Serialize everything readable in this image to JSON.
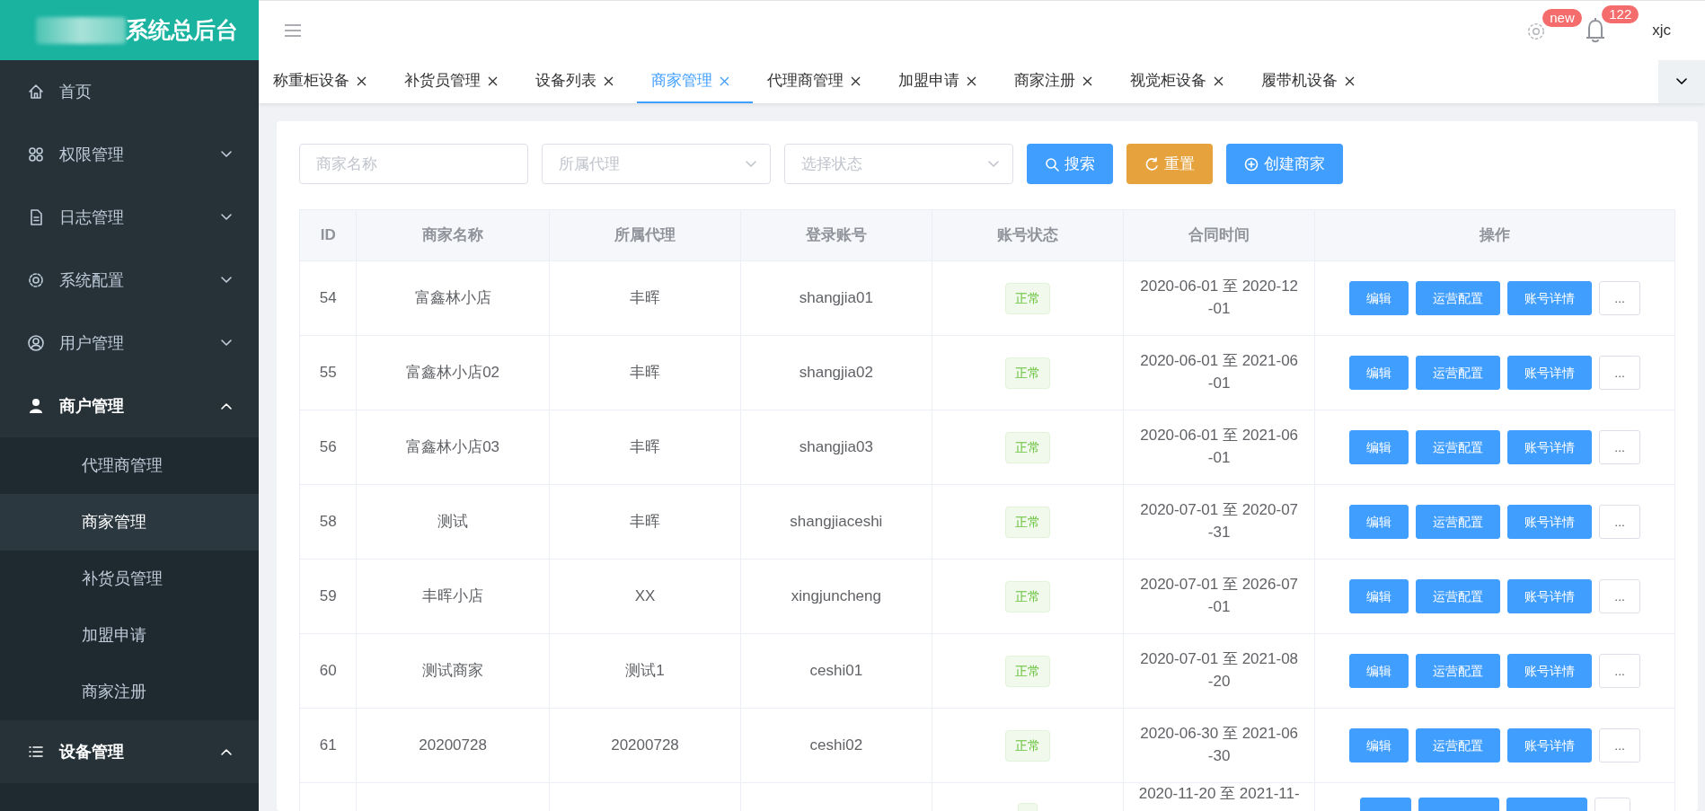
{
  "brand": {
    "title": "系统总后台"
  },
  "sidebar": {
    "items": [
      {
        "label": "首页",
        "kind": "link"
      },
      {
        "label": "权限管理",
        "kind": "menu",
        "expanded": false
      },
      {
        "label": "日志管理",
        "kind": "menu",
        "expanded": false
      },
      {
        "label": "系统配置",
        "kind": "menu",
        "expanded": false
      },
      {
        "label": "用户管理",
        "kind": "menu",
        "expanded": false
      },
      {
        "label": "商户管理",
        "kind": "menu",
        "expanded": true,
        "children": [
          {
            "label": "代理商管理",
            "selected": false
          },
          {
            "label": "商家管理",
            "selected": true
          },
          {
            "label": "补货员管理",
            "selected": false
          },
          {
            "label": "加盟申请",
            "selected": false
          },
          {
            "label": "商家注册",
            "selected": false
          }
        ]
      },
      {
        "label": "设备管理",
        "kind": "menu",
        "expanded": true
      }
    ]
  },
  "header": {
    "settings_badge": "new",
    "notification_badge": "122",
    "user": "xjc"
  },
  "tabs": [
    {
      "label": "称重柜设备",
      "selected": false
    },
    {
      "label": "补货员管理",
      "selected": false
    },
    {
      "label": "设备列表",
      "selected": false
    },
    {
      "label": "商家管理",
      "selected": true
    },
    {
      "label": "代理商管理",
      "selected": false
    },
    {
      "label": "加盟申请",
      "selected": false
    },
    {
      "label": "商家注册",
      "selected": false
    },
    {
      "label": "视觉柜设备",
      "selected": false
    },
    {
      "label": "履带机设备",
      "selected": false
    }
  ],
  "filters": {
    "name": {
      "placeholder": "商家名称"
    },
    "agent": {
      "placeholder": "所属代理"
    },
    "status": {
      "placeholder": "选择状态"
    },
    "buttons": [
      {
        "label": "搜索",
        "kind": "search"
      },
      {
        "label": "重置",
        "kind": "reset"
      },
      {
        "label": "创建商家",
        "kind": "create"
      }
    ]
  },
  "table": {
    "columns": [
      "ID",
      "商家名称",
      "所属代理",
      "登录账号",
      "账号状态",
      "合同时间",
      "操作"
    ],
    "rows": [
      {
        "id": "54",
        "name": "富鑫林小店",
        "agent": "丰晖",
        "account": "shangjia01",
        "status": "正常",
        "contract": "2020-06-01 至 2020-12-01",
        "actions": [
          "编辑",
          "运营配置",
          "账号详情",
          "..."
        ]
      },
      {
        "id": "55",
        "name": "富鑫林小店02",
        "agent": "丰晖",
        "account": "shangjia02",
        "status": "正常",
        "contract": "2020-06-01 至 2021-06-01",
        "actions": [
          "编辑",
          "运营配置",
          "账号详情",
          "..."
        ]
      },
      {
        "id": "56",
        "name": "富鑫林小店03",
        "agent": "丰晖",
        "account": "shangjia03",
        "status": "正常",
        "contract": "2020-06-01 至 2021-06-01",
        "actions": [
          "编辑",
          "运营配置",
          "账号详情",
          "..."
        ]
      },
      {
        "id": "58",
        "name": "测试",
        "agent": "丰晖",
        "account": "shangjiaceshi",
        "status": "正常",
        "contract": "2020-07-01 至 2020-07-31",
        "actions": [
          "编辑",
          "运营配置",
          "账号详情",
          "..."
        ]
      },
      {
        "id": "59",
        "name": "丰晖小店",
        "agent": "XX",
        "account": "xingjuncheng",
        "status": "正常",
        "contract": "2020-07-01 至 2026-07-01",
        "actions": [
          "编辑",
          "运营配置",
          "账号详情",
          "..."
        ]
      },
      {
        "id": "60",
        "name": "测试商家",
        "agent": "测试1",
        "account": "ceshi01",
        "status": "正常",
        "contract": "2020-07-01 至 2021-08-20",
        "actions": [
          "编辑",
          "运营配置",
          "账号详情",
          "..."
        ]
      },
      {
        "id": "61",
        "name": "20200728",
        "agent": "20200728",
        "account": "ceshi02",
        "status": "正常",
        "contract": "2020-06-30 至 2021-06-30",
        "actions": [
          "编辑",
          "运营配置",
          "账号详情",
          "..."
        ]
      },
      {
        "contract": "2020-11-20 至 2021-11-"
      }
    ]
  }
}
